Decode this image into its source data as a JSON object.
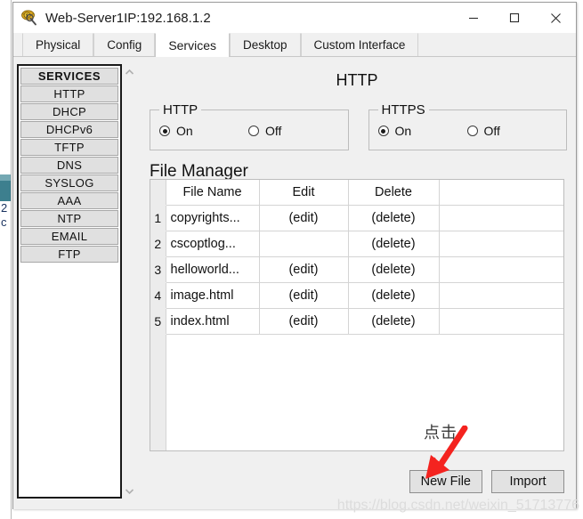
{
  "window": {
    "title": "Web-Server1IP:192.168.1.2",
    "icon": "packet-tracer-server-icon",
    "minimize_label": "—",
    "maximize_label": "□",
    "close_label": "✕"
  },
  "tabs": [
    {
      "label": "Physical",
      "active": false
    },
    {
      "label": "Config",
      "active": false
    },
    {
      "label": "Services",
      "active": true
    },
    {
      "label": "Desktop",
      "active": false
    },
    {
      "label": "Custom Interface",
      "active": false
    }
  ],
  "sidebar": {
    "header": "SERVICES",
    "items": [
      {
        "label": "HTTP"
      },
      {
        "label": "DHCP"
      },
      {
        "label": "DHCPv6"
      },
      {
        "label": "TFTP"
      },
      {
        "label": "DNS"
      },
      {
        "label": "SYSLOG"
      },
      {
        "label": "AAA"
      },
      {
        "label": "NTP"
      },
      {
        "label": "EMAIL"
      },
      {
        "label": "FTP"
      }
    ],
    "scroll_up_icon": "chevron-up-icon",
    "scroll_down_icon": "chevron-down-icon"
  },
  "panel": {
    "title": "HTTP",
    "groups": [
      {
        "legend": "HTTP",
        "on_label": "On",
        "off_label": "Off",
        "selected": "On"
      },
      {
        "legend": "HTTPS",
        "on_label": "On",
        "off_label": "Off",
        "selected": "On"
      }
    ],
    "file_manager": {
      "title": "File Manager",
      "columns": [
        "",
        "File Name",
        "Edit",
        "Delete",
        ""
      ],
      "rows": [
        {
          "num": "1",
          "name": "copyrights...",
          "edit": "(edit)",
          "delete": "(delete)"
        },
        {
          "num": "2",
          "name": "cscoptlog...",
          "edit": "",
          "delete": "(delete)"
        },
        {
          "num": "3",
          "name": "helloworld...",
          "edit": "(edit)",
          "delete": "(delete)"
        },
        {
          "num": "4",
          "name": "image.html",
          "edit": "(edit)",
          "delete": "(delete)"
        },
        {
          "num": "5",
          "name": "index.html",
          "edit": "(edit)",
          "delete": "(delete)"
        }
      ]
    },
    "buttons": {
      "new_file": "New File",
      "import": "Import"
    }
  },
  "annotation": {
    "text": "点击",
    "arrow_color": "#f4231f",
    "arrow_icon": "red-arrow-icon"
  },
  "watermark": "https://blog.csdn.net/weixin_51713776",
  "background_fragments": {
    "frag1": "2",
    "frag2": "c"
  },
  "colors": {
    "accent_red": "#f4231f",
    "window_bg": "#f0f0f0",
    "panel_bg": "#ffffff",
    "button_bg": "#e2e2e2",
    "sidebar_item_bg": "#e0e0e0",
    "teal_fragment": "#3d7f8e"
  }
}
